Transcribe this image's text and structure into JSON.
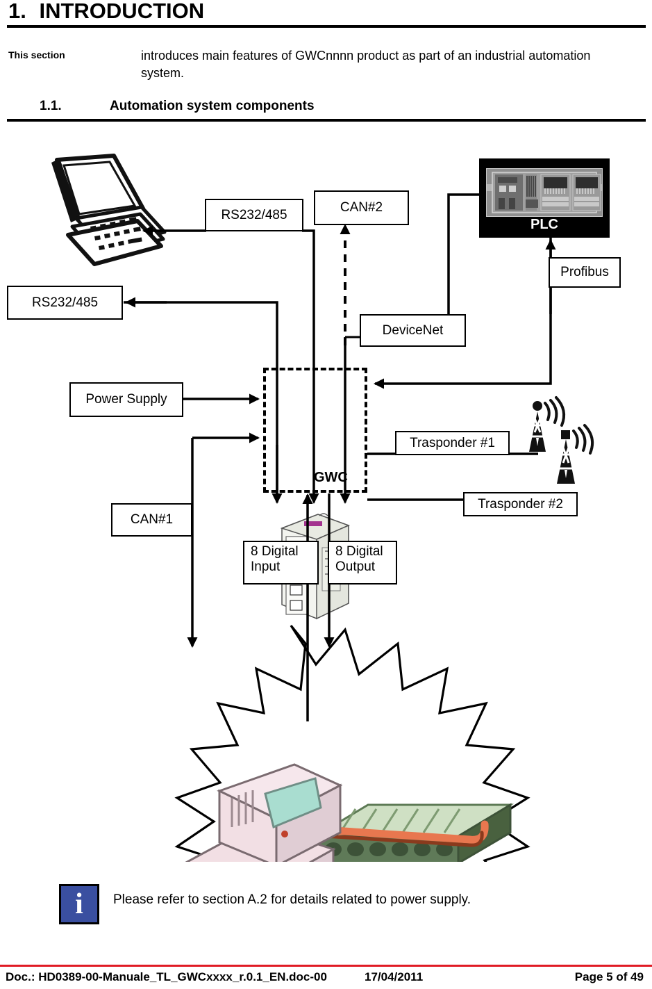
{
  "document": {
    "chapter_number": "1.",
    "chapter_title": "INTRODUCTION",
    "marginal_label": "This section",
    "intro_paragraph": "introduces main features of GWCnnnn product as part of an industrial automation system.",
    "subsection_number": "1.1.",
    "subsection_title": "Automation system components"
  },
  "diagram": {
    "boxes": {
      "rs232_top": "RS232/485",
      "rs232_left": "RS232/485",
      "can2": "CAN#2",
      "devicenet": "DeviceNet",
      "profibus": "Profibus",
      "power_supply": "Power Supply",
      "can1": "CAN#1",
      "digital_input": "8 Digital Input",
      "digital_input_line1": "8 Digital",
      "digital_input_line2": "Input",
      "digital_output_line1": "8 Digital",
      "digital_output_line2": "Output",
      "trasponder1": "Trasponder #1",
      "trasponder2": "Trasponder #2"
    },
    "plc_label": "PLC",
    "gwc_label": "GWC"
  },
  "note": {
    "icon": "info-icon",
    "text": "Please refer to section A.2 for details related to power supply."
  },
  "footer": {
    "doc": "Doc.: HD0389-00-Manuale_TL_GWCxxxx_r.0.1_EN.doc-00",
    "date": "17/04/2011",
    "page": "Page 5 of 49"
  },
  "colors": {
    "footer_rule": "#e01b24",
    "info_badge": "#3a4fa0",
    "machine_body": "#f2dfe4",
    "machine_screen": "#a9ddd0",
    "conveyor": "#cfe0c4",
    "arm": "#e8774f"
  }
}
